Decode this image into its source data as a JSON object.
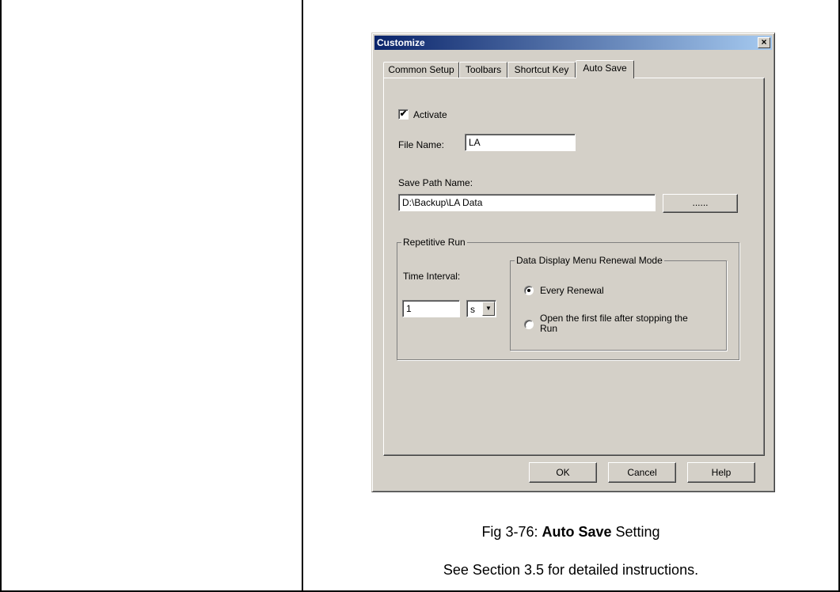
{
  "dialog": {
    "title": "Customize",
    "close_glyph": "×",
    "tabs": [
      {
        "label": "Common Setup",
        "active": false
      },
      {
        "label": "Toolbars",
        "active": false
      },
      {
        "label": "Shortcut Key",
        "active": false
      },
      {
        "label": "Auto Save",
        "active": true
      }
    ],
    "activate": {
      "label": "Activate",
      "checked": true,
      "check_glyph": "✔"
    },
    "file_name": {
      "label": "File Name:",
      "value": "LA"
    },
    "save_path": {
      "label": "Save Path Name:",
      "value": "D:\\Backup\\LA Data",
      "browse_label": "......"
    },
    "repetitive_run": {
      "legend": "Repetitive Run",
      "time_interval_label": "Time Interval:",
      "time_interval_value": "1",
      "unit_value": "s",
      "unit_arrow": "▼"
    },
    "renewal_mode": {
      "legend": "Data Display Menu Renewal Mode",
      "options": [
        {
          "label": "Every Renewal",
          "checked": true
        },
        {
          "label_line1": "Open the first file after stopping the",
          "label_line2": "Run",
          "checked": false
        }
      ]
    },
    "buttons": {
      "ok": "OK",
      "cancel": "Cancel",
      "help": "Help"
    }
  },
  "caption": {
    "prefix": "Fig 3-76: ",
    "bold": "Auto Save",
    "suffix": " Setting",
    "note": "See Section 3.5 for detailed instructions."
  }
}
